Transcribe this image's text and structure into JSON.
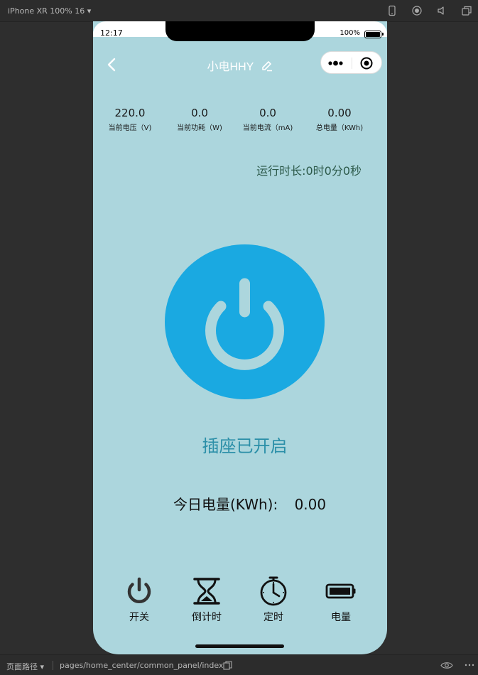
{
  "devtools": {
    "device_label": "iPhone XR 100% 16 ▾",
    "path_label": "页面路径 ▾",
    "path_value": "pages/home_center/common_panel/index"
  },
  "status_bar": {
    "time": "12:17",
    "battery_pct": "100%"
  },
  "nav": {
    "title": "小电HHY"
  },
  "readings": [
    {
      "value": "220.0",
      "label": "当前电压（V)"
    },
    {
      "value": "0.0",
      "label": "当前功耗（W)"
    },
    {
      "value": "0.0",
      "label": "当前电流（mA)"
    },
    {
      "value": "0.00",
      "label": "总电量（KWh)"
    }
  ],
  "run_time": "运行时长:0时0分0秒",
  "power": {
    "status_text": "插座已开启",
    "button_color": "#1aa9e1",
    "icon_color": "#acd6dd"
  },
  "today": {
    "label": "今日电量(KWh):",
    "value": "0.00"
  },
  "tabs": [
    {
      "label": "开关",
      "icon": "power-icon"
    },
    {
      "label": "倒计时",
      "icon": "hourglass-icon"
    },
    {
      "label": "定时",
      "icon": "stopwatch-icon"
    },
    {
      "label": "电量",
      "icon": "battery-icon"
    }
  ],
  "colors": {
    "background": "#acd6dd",
    "status_text": "#2b8fa8",
    "runtime_text": "#2d5a4a"
  }
}
